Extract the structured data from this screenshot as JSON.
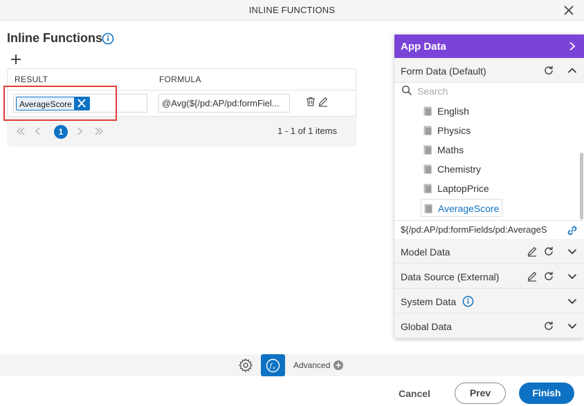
{
  "dialog": {
    "title": "INLINE FUNCTIONS",
    "close_icon": "close-icon"
  },
  "page": {
    "title": "Inline Functions",
    "info_icon": "info-icon",
    "add_icon": "plus-icon"
  },
  "table": {
    "columns": [
      "RESULT",
      "FORMULA"
    ],
    "rows": [
      {
        "result": "AverageScore",
        "formula": "@Avg(${/pd:AP/pd:formFiel..."
      }
    ],
    "row_icons": [
      "trash-icon",
      "pencil-icon"
    ],
    "pagination": {
      "current_page": "1",
      "count_text": "1 - 1 of 1 items"
    }
  },
  "app_data": {
    "title": "App Data",
    "form_data": {
      "label": "Form Data (Default)",
      "search_placeholder": "Search",
      "items": [
        "English",
        "Physics",
        "Maths",
        "Chemistry",
        "LaptopPrice",
        "AverageScore"
      ],
      "selected": "AverageScore",
      "path": "${/pd:AP/pd:formFields/pd:AverageS"
    },
    "sections": [
      {
        "label": "Model Data"
      },
      {
        "label": "Data Source (External)"
      },
      {
        "label": "System Data"
      },
      {
        "label": "Global Data"
      }
    ]
  },
  "bottom": {
    "advanced_label": "Advanced"
  },
  "footer": {
    "cancel": "Cancel",
    "prev": "Prev",
    "finish": "Finish"
  },
  "colors": {
    "accent": "#0e72c4",
    "panel_header": "#7b44d8",
    "highlight": "#e53935"
  }
}
